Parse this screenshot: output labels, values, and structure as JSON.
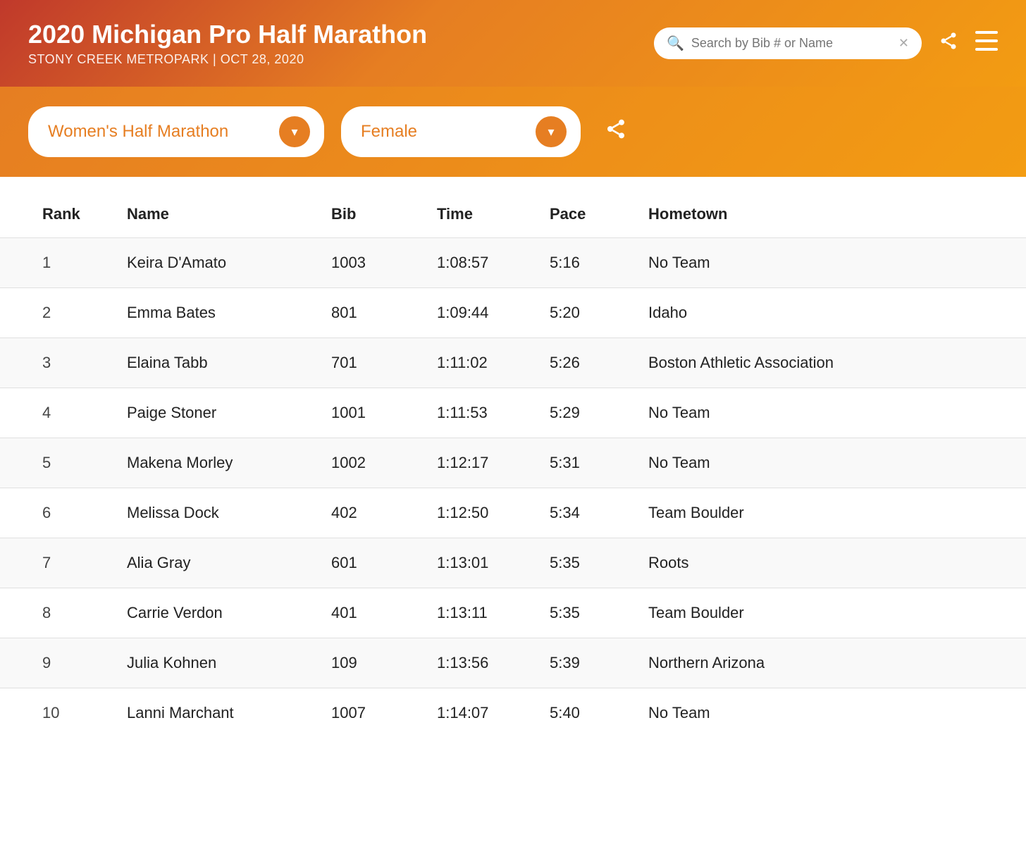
{
  "header": {
    "title": "2020 Michigan Pro Half Marathon",
    "subtitle": "STONY CREEK METROPARK  |  OCT 28, 2020",
    "search_placeholder": "Search by Bib # or Name"
  },
  "filter": {
    "race_label": "Women's Half Marathon",
    "gender_label": "Female",
    "chevron": "▾"
  },
  "table": {
    "columns": [
      "Rank",
      "Name",
      "Bib",
      "Time",
      "Pace",
      "Hometown"
    ],
    "rows": [
      {
        "rank": "1",
        "name": "Keira D'Amato",
        "bib": "1003",
        "time": "1:08:57",
        "pace": "5:16",
        "hometown": "No Team"
      },
      {
        "rank": "2",
        "name": "Emma Bates",
        "bib": "801",
        "time": "1:09:44",
        "pace": "5:20",
        "hometown": "Idaho"
      },
      {
        "rank": "3",
        "name": "Elaina Tabb",
        "bib": "701",
        "time": "1:11:02",
        "pace": "5:26",
        "hometown": "Boston Athletic Association"
      },
      {
        "rank": "4",
        "name": "Paige Stoner",
        "bib": "1001",
        "time": "1:11:53",
        "pace": "5:29",
        "hometown": "No Team"
      },
      {
        "rank": "5",
        "name": "Makena Morley",
        "bib": "1002",
        "time": "1:12:17",
        "pace": "5:31",
        "hometown": "No Team"
      },
      {
        "rank": "6",
        "name": "Melissa Dock",
        "bib": "402",
        "time": "1:12:50",
        "pace": "5:34",
        "hometown": "Team Boulder"
      },
      {
        "rank": "7",
        "name": "Alia Gray",
        "bib": "601",
        "time": "1:13:01",
        "pace": "5:35",
        "hometown": "Roots"
      },
      {
        "rank": "8",
        "name": "Carrie Verdon",
        "bib": "401",
        "time": "1:13:11",
        "pace": "5:35",
        "hometown": "Team Boulder"
      },
      {
        "rank": "9",
        "name": "Julia Kohnen",
        "bib": "109",
        "time": "1:13:56",
        "pace": "5:39",
        "hometown": "Northern Arizona"
      },
      {
        "rank": "10",
        "name": "Lanni Marchant",
        "bib": "1007",
        "time": "1:14:07",
        "pace": "5:40",
        "hometown": "No Team"
      }
    ]
  }
}
